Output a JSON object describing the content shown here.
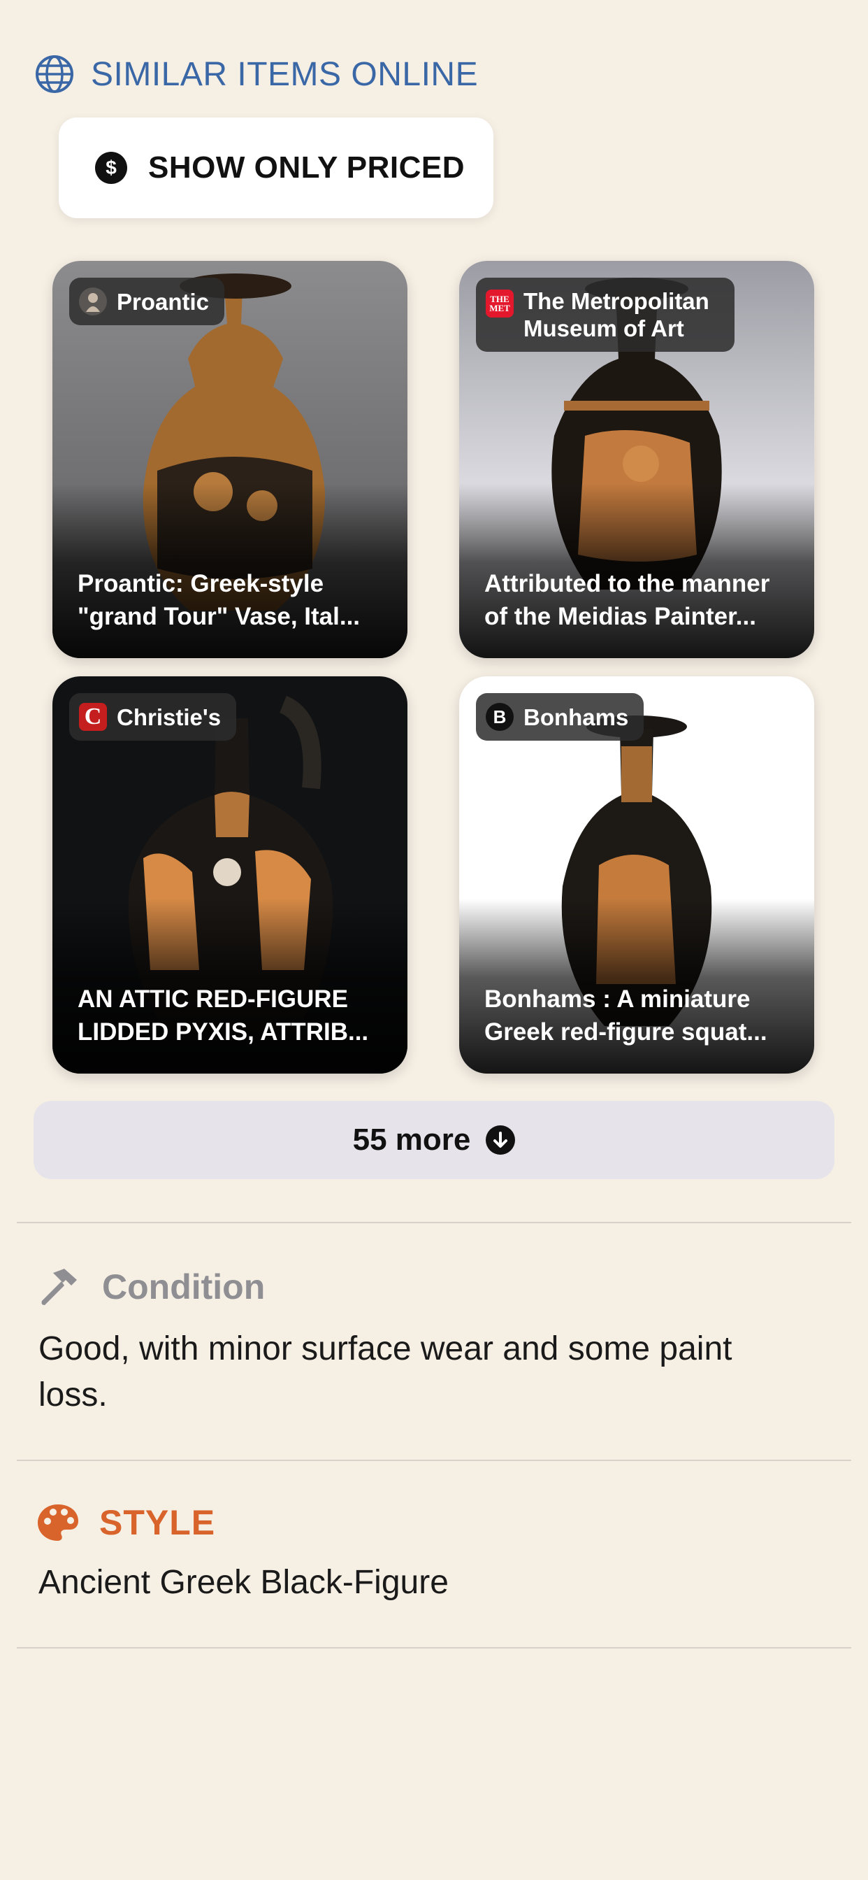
{
  "similar_items": {
    "title": "SIMILAR ITEMS ONLINE",
    "filter_label": "SHOW ONLY PRICED",
    "filter_icon": "$",
    "cards": [
      {
        "source": "Proantic",
        "title": "Proantic: Greek-style \"grand Tour\" Vase, Ital...",
        "bg": "#6e6e70"
      },
      {
        "source": "The Metropolitan Museum of Art",
        "source_logo_text": "THE MET",
        "title": "Attributed to the manner of the Meidias Painter...",
        "bg": "#c9c9cf"
      },
      {
        "source": "Christie's",
        "source_logo_text": "C",
        "title": "AN ATTIC RED-FIGURE LIDDED PYXIS, ATTRIB...",
        "bg": "#101214"
      },
      {
        "source": "Bonhams",
        "source_logo_text": "B",
        "title": "Bonhams : A miniature Greek red-figure squat...",
        "bg": "#ffffff"
      }
    ],
    "more_label": "55 more"
  },
  "condition": {
    "title": "Condition",
    "text": "Good, with minor surface wear and some paint loss."
  },
  "style": {
    "title": "STYLE",
    "text": "Ancient Greek Black-Figure"
  },
  "colors": {
    "background": "#f6efe4",
    "accent_blue": "#3a67a6",
    "accent_orange": "#d9642b"
  },
  "icons": [
    "globe-icon",
    "dollar-icon",
    "down-arrow-icon",
    "hammer-icon",
    "palette-icon"
  ]
}
